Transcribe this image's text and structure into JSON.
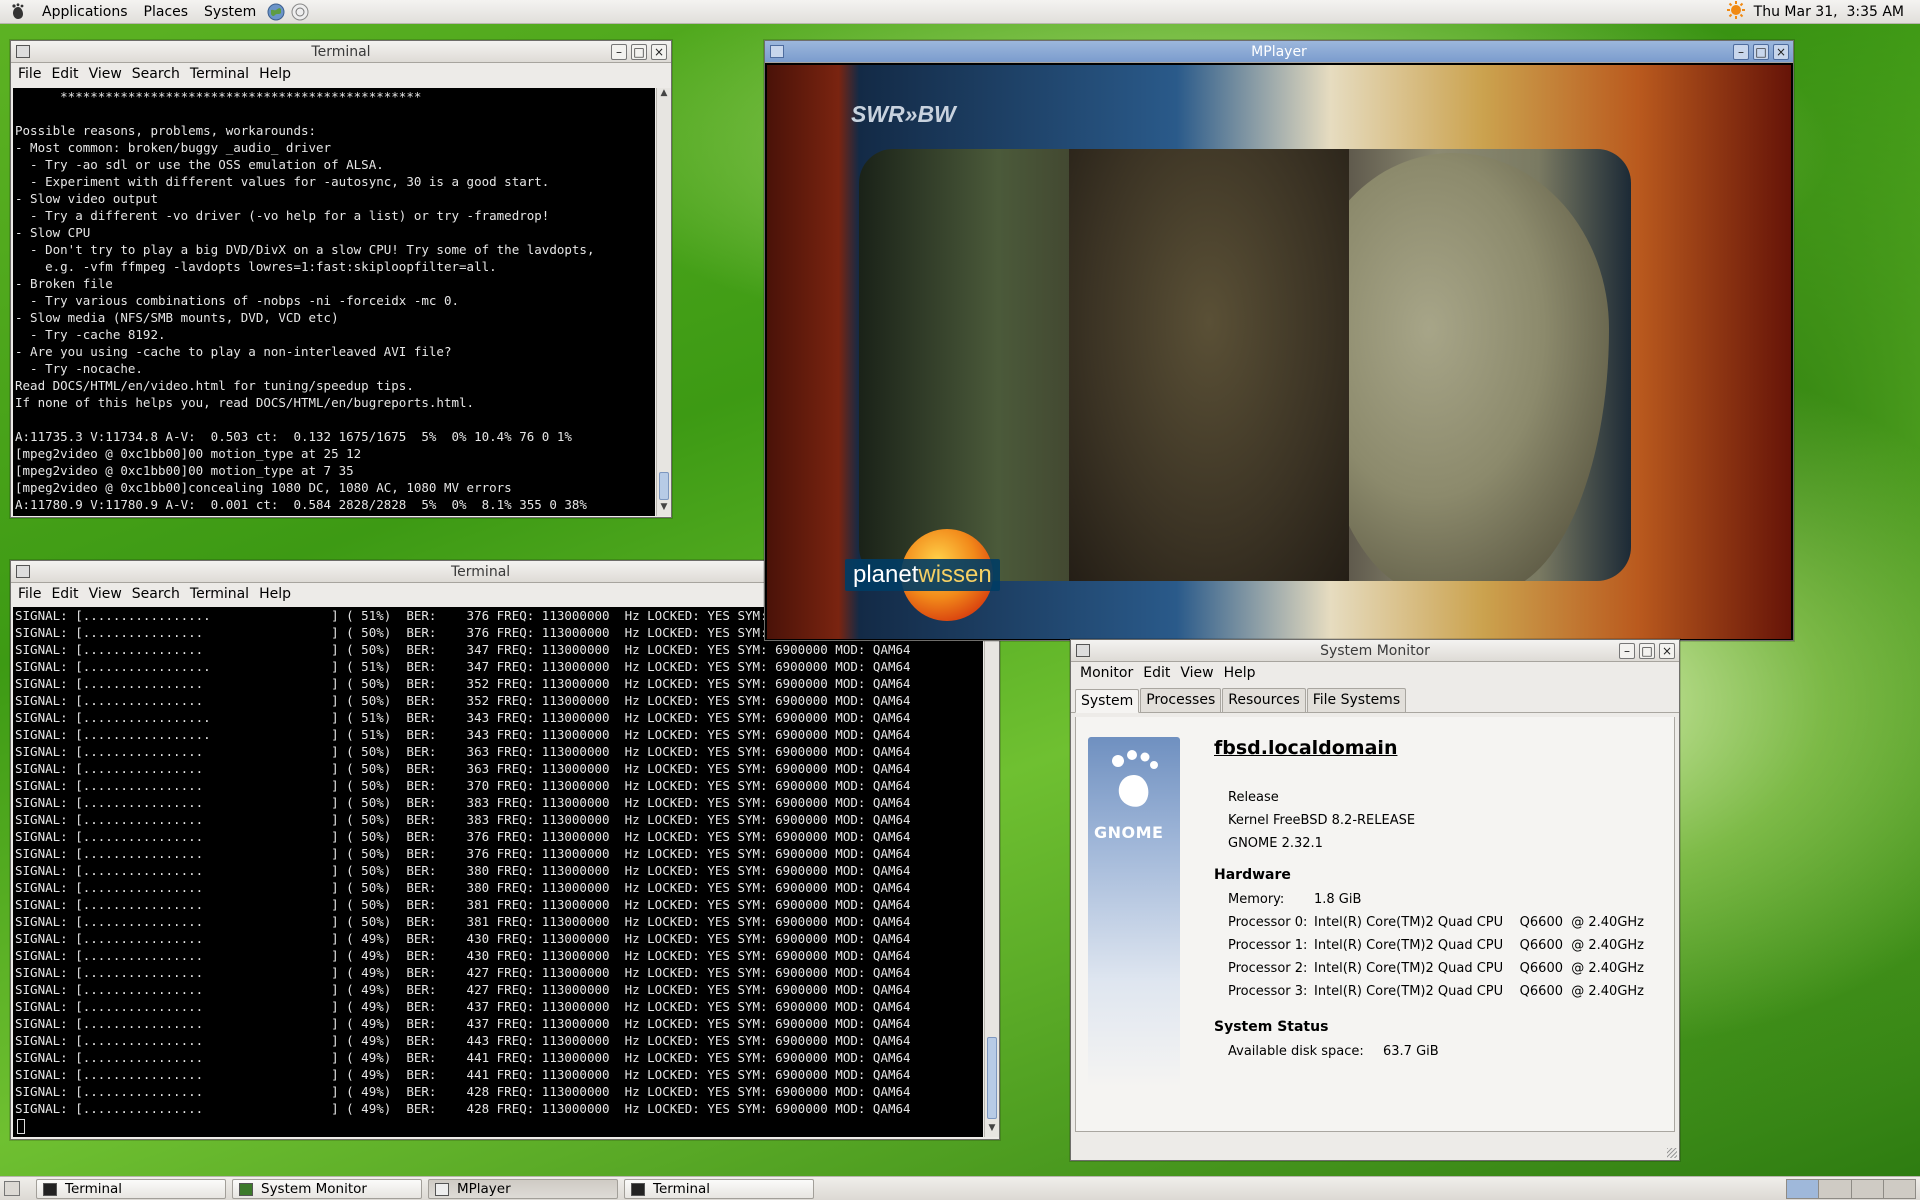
{
  "topbar": {
    "applications": "Applications",
    "places": "Places",
    "system": "System",
    "clock": "Thu Mar 31,  3:35 AM"
  },
  "term1": {
    "title": "Terminal",
    "menu": [
      "File",
      "Edit",
      "View",
      "Search",
      "Terminal",
      "Help"
    ],
    "text": "      ************************************************\n\nPossible reasons, problems, workarounds:\n- Most common: broken/buggy _audio_ driver\n  - Try -ao sdl or use the OSS emulation of ALSA.\n  - Experiment with different values for -autosync, 30 is a good start.\n- Slow video output\n  - Try a different -vo driver (-vo help for a list) or try -framedrop!\n- Slow CPU\n  - Don't try to play a big DVD/DivX on a slow CPU! Try some of the lavdopts,\n    e.g. -vfm ffmpeg -lavdopts lowres=1:fast:skiploopfilter=all.\n- Broken file\n  - Try various combinations of -nobps -ni -forceidx -mc 0.\n- Slow media (NFS/SMB mounts, DVD, VCD etc)\n  - Try -cache 8192.\n- Are you using -cache to play a non-interleaved AVI file?\n  - Try -nocache.\nRead DOCS/HTML/en/video.html for tuning/speedup tips.\nIf none of this helps you, read DOCS/HTML/en/bugreports.html.\n\nA:11735.3 V:11734.8 A-V:  0.503 ct:  0.132 1675/1675  5%  0% 10.4% 76 0 1%\n[mpeg2video @ 0xc1bb00]00 motion_type at 25 12\n[mpeg2video @ 0xc1bb00]00 motion_type at 7 35\n[mpeg2video @ 0xc1bb00]concealing 1080 DC, 1080 AC, 1080 MV errors\nA:11780.9 V:11780.9 A-V:  0.001 ct:  0.584 2828/2828  5%  0%  8.1% 355 0 38%"
  },
  "term2": {
    "title": "Terminal",
    "menu": [
      "File",
      "Edit",
      "View",
      "Search",
      "Terminal",
      "Help"
    ],
    "text": "SIGNAL: [.................                ] ( 51%)  BER:    376 FREQ: 113000000  Hz LOCKED: YES SYM: 6900000 MOD: QAM64\nSIGNAL: [................                 ] ( 50%)  BER:    376 FREQ: 113000000  Hz LOCKED: YES SYM: 6900000 MOD: QAM64\nSIGNAL: [................                 ] ( 50%)  BER:    347 FREQ: 113000000  Hz LOCKED: YES SYM: 6900000 MOD: QAM64\nSIGNAL: [.................                ] ( 51%)  BER:    347 FREQ: 113000000  Hz LOCKED: YES SYM: 6900000 MOD: QAM64\nSIGNAL: [................                 ] ( 50%)  BER:    352 FREQ: 113000000  Hz LOCKED: YES SYM: 6900000 MOD: QAM64\nSIGNAL: [................                 ] ( 50%)  BER:    352 FREQ: 113000000  Hz LOCKED: YES SYM: 6900000 MOD: QAM64\nSIGNAL: [.................                ] ( 51%)  BER:    343 FREQ: 113000000  Hz LOCKED: YES SYM: 6900000 MOD: QAM64\nSIGNAL: [.................                ] ( 51%)  BER:    343 FREQ: 113000000  Hz LOCKED: YES SYM: 6900000 MOD: QAM64\nSIGNAL: [................                 ] ( 50%)  BER:    363 FREQ: 113000000  Hz LOCKED: YES SYM: 6900000 MOD: QAM64\nSIGNAL: [................                 ] ( 50%)  BER:    363 FREQ: 113000000  Hz LOCKED: YES SYM: 6900000 MOD: QAM64\nSIGNAL: [................                 ] ( 50%)  BER:    370 FREQ: 113000000  Hz LOCKED: YES SYM: 6900000 MOD: QAM64\nSIGNAL: [................                 ] ( 50%)  BER:    383 FREQ: 113000000  Hz LOCKED: YES SYM: 6900000 MOD: QAM64\nSIGNAL: [................                 ] ( 50%)  BER:    383 FREQ: 113000000  Hz LOCKED: YES SYM: 6900000 MOD: QAM64\nSIGNAL: [................                 ] ( 50%)  BER:    376 FREQ: 113000000  Hz LOCKED: YES SYM: 6900000 MOD: QAM64\nSIGNAL: [................                 ] ( 50%)  BER:    376 FREQ: 113000000  Hz LOCKED: YES SYM: 6900000 MOD: QAM64\nSIGNAL: [................                 ] ( 50%)  BER:    380 FREQ: 113000000  Hz LOCKED: YES SYM: 6900000 MOD: QAM64\nSIGNAL: [................                 ] ( 50%)  BER:    380 FREQ: 113000000  Hz LOCKED: YES SYM: 6900000 MOD: QAM64\nSIGNAL: [................                 ] ( 50%)  BER:    381 FREQ: 113000000  Hz LOCKED: YES SYM: 6900000 MOD: QAM64\nSIGNAL: [................                 ] ( 50%)  BER:    381 FREQ: 113000000  Hz LOCKED: YES SYM: 6900000 MOD: QAM64\nSIGNAL: [................                 ] ( 49%)  BER:    430 FREQ: 113000000  Hz LOCKED: YES SYM: 6900000 MOD: QAM64\nSIGNAL: [................                 ] ( 49%)  BER:    430 FREQ: 113000000  Hz LOCKED: YES SYM: 6900000 MOD: QAM64\nSIGNAL: [................                 ] ( 49%)  BER:    427 FREQ: 113000000  Hz LOCKED: YES SYM: 6900000 MOD: QAM64\nSIGNAL: [................                 ] ( 49%)  BER:    427 FREQ: 113000000  Hz LOCKED: YES SYM: 6900000 MOD: QAM64\nSIGNAL: [................                 ] ( 49%)  BER:    437 FREQ: 113000000  Hz LOCKED: YES SYM: 6900000 MOD: QAM64\nSIGNAL: [................                 ] ( 49%)  BER:    437 FREQ: 113000000  Hz LOCKED: YES SYM: 6900000 MOD: QAM64\nSIGNAL: [................                 ] ( 49%)  BER:    443 FREQ: 113000000  Hz LOCKED: YES SYM: 6900000 MOD: QAM64\nSIGNAL: [................                 ] ( 49%)  BER:    441 FREQ: 113000000  Hz LOCKED: YES SYM: 6900000 MOD: QAM64\nSIGNAL: [................                 ] ( 49%)  BER:    441 FREQ: 113000000  Hz LOCKED: YES SYM: 6900000 MOD: QAM64\nSIGNAL: [................                 ] ( 49%)  BER:    428 FREQ: 113000000  Hz LOCKED: YES SYM: 6900000 MOD: QAM64\nSIGNAL: [................                 ] ( 49%)  BER:    428 FREQ: 113000000  Hz LOCKED: YES SYM: 6900000 MOD: QAM64"
  },
  "mplayer": {
    "title": "MPlayer",
    "channel_logo": "SWR»BW",
    "show_logo_left": "planet",
    "show_logo_right": "wissen"
  },
  "sysmon": {
    "title": "System Monitor",
    "menu": [
      "Monitor",
      "Edit",
      "View",
      "Help"
    ],
    "tabs": [
      "System",
      "Processes",
      "Resources",
      "File Systems"
    ],
    "gnome_label": "GNOME",
    "hostname": "fbsd.localdomain",
    "release": "Release",
    "kernel": "Kernel FreeBSD 8.2-RELEASE",
    "gnome_version": "GNOME 2.32.1",
    "hardware_heading": "Hardware",
    "memory_label": "Memory:",
    "memory_value": "1.8 GiB",
    "processors": [
      {
        "label": "Processor 0:",
        "value": "Intel(R) Core(TM)2 Quad CPU    Q6600  @ 2.40GHz"
      },
      {
        "label": "Processor 1:",
        "value": "Intel(R) Core(TM)2 Quad CPU    Q6600  @ 2.40GHz"
      },
      {
        "label": "Processor 2:",
        "value": "Intel(R) Core(TM)2 Quad CPU    Q6600  @ 2.40GHz"
      },
      {
        "label": "Processor 3:",
        "value": "Intel(R) Core(TM)2 Quad CPU    Q6600  @ 2.40GHz"
      }
    ],
    "status_heading": "System Status",
    "disk_label": "Available disk space:",
    "disk_value": "63.7 GiB"
  },
  "taskbar": [
    {
      "label": "Terminal"
    },
    {
      "label": "System Monitor"
    },
    {
      "label": "MPlayer"
    },
    {
      "label": "Terminal"
    }
  ],
  "colors": {
    "accent": "#7b9ccd",
    "terminal_bg": "#000000",
    "terminal_fg": "#e6e6e6"
  }
}
